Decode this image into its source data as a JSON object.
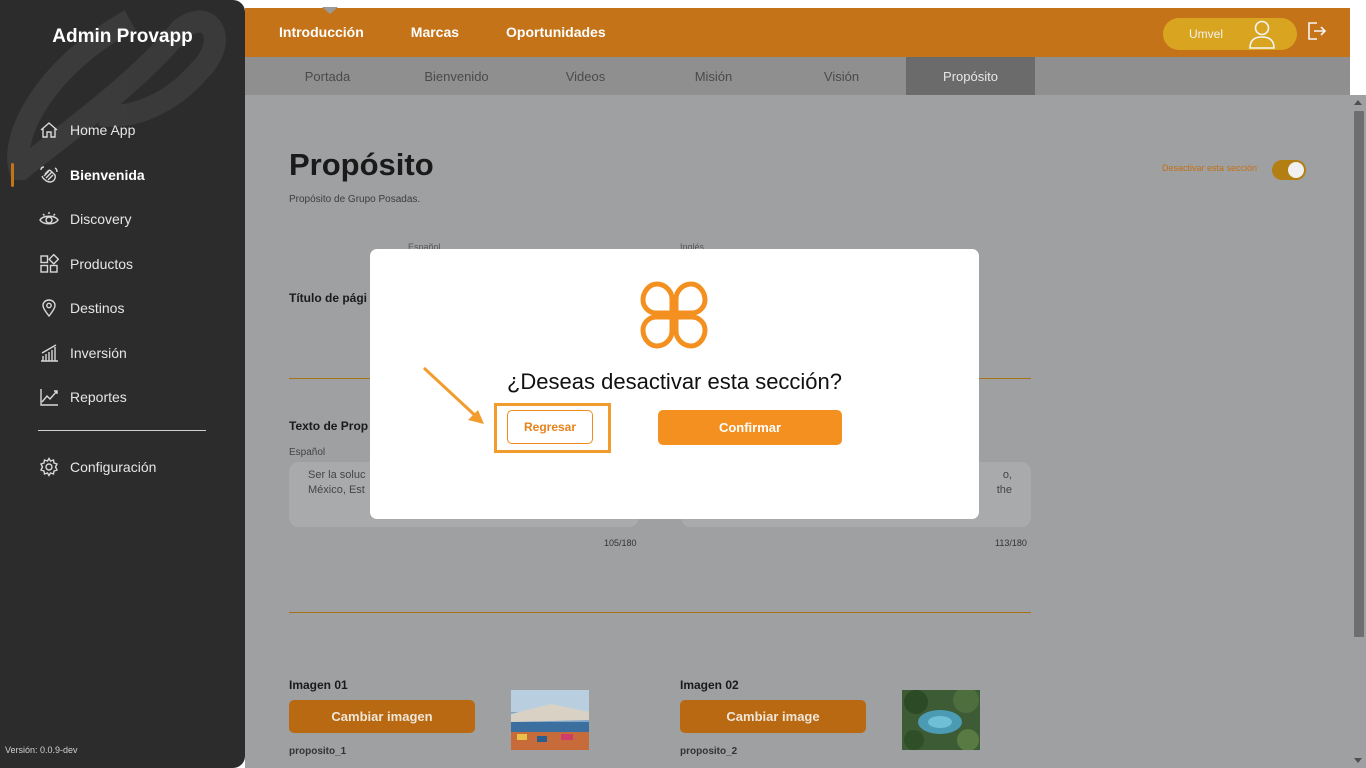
{
  "sidebar": {
    "brand": "Admin Provapp",
    "items": [
      {
        "label": "Home App",
        "icon": "home-icon"
      },
      {
        "label": "Bienvenida",
        "icon": "wave-hand-icon",
        "active": true
      },
      {
        "label": "Discovery",
        "icon": "eye-icon"
      },
      {
        "label": "Productos",
        "icon": "grid-icon"
      },
      {
        "label": "Destinos",
        "icon": "location-pin-icon"
      },
      {
        "label": "Inversión",
        "icon": "bar-chart-icon"
      },
      {
        "label": "Reportes",
        "icon": "line-chart-icon"
      }
    ],
    "settings_label": "Configuración",
    "version": "Versión: 0.0.9-dev"
  },
  "header": {
    "tabs": [
      "Introducción",
      "Marcas",
      "Oportunidades"
    ],
    "user_name": "Umvel"
  },
  "subnav": {
    "tabs": [
      "Portada",
      "Bienvenido",
      "Videos",
      "Misión",
      "Visión",
      "Propósito"
    ],
    "active": "Propósito"
  },
  "main": {
    "title": "Propósito",
    "subtitle": "Propósito de Grupo Posadas.",
    "toggle_label": "Desactivar esta sección",
    "toggle_on": true,
    "col_es": "Español",
    "col_en": "Inglés",
    "page_title_label": "Título de pági",
    "text_label": "Texto de Prop",
    "text_lang_label": "Español",
    "text_es_line1": "Ser la soluc",
    "text_es_line2": "México, Est",
    "text_en_line1": "o,",
    "text_en_line2": "the",
    "count_es": "105/180",
    "count_en": "113/180",
    "images": [
      {
        "label": "Imagen 01",
        "button": "Cambiar imagen",
        "name": "proposito_1"
      },
      {
        "label": "Imagen 02",
        "button": "Cambiar image",
        "name": "proposito_2"
      }
    ]
  },
  "modal": {
    "title": "¿Deseas desactivar esta sección?",
    "back_label": "Regresar",
    "confirm_label": "Confirmar"
  },
  "colors": {
    "accent": "#c57318",
    "modal_button": "#f39020",
    "sidebar_bg": "#2c2c2c"
  }
}
